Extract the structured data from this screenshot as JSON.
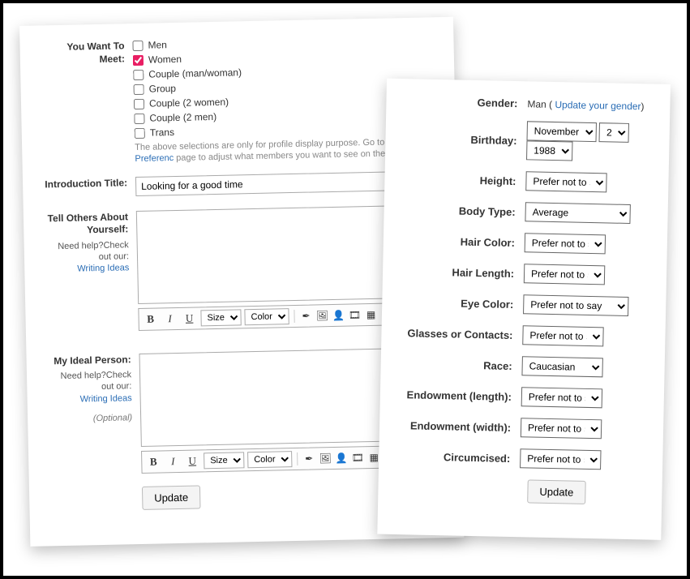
{
  "left": {
    "meet_label": "You Want To Meet:",
    "meet_options": [
      {
        "label": "Men",
        "checked": false
      },
      {
        "label": "Women",
        "checked": true
      },
      {
        "label": "Couple (man/woman)",
        "checked": false
      },
      {
        "label": "Group",
        "checked": false
      },
      {
        "label": "Couple (2 women)",
        "checked": false
      },
      {
        "label": "Couple (2 men)",
        "checked": false
      },
      {
        "label": "Trans",
        "checked": false
      }
    ],
    "meet_note_pre": "The above selections are only for profile display purpose. Go to ",
    "meet_note_link": "Cupid Preferenc",
    "meet_note_post": " page to adjust what members you want to see on the site.",
    "intro_label": "Introduction Title:",
    "intro_value": "Looking for a good time",
    "about_label": "Tell Others About Yourself:",
    "help_prefix": "Need help?Check out our:",
    "help_link": "Writing Ideas",
    "ideal_label": "My Ideal Person:",
    "optional": "(Optional)",
    "toolbar": {
      "bold": "B",
      "italic": "I",
      "underline": "U",
      "size": "Size",
      "color": "Color",
      "question": "?"
    },
    "update_btn": "Update"
  },
  "right": {
    "gender_label": "Gender:",
    "gender_value_prefix": "Man ( ",
    "gender_link": "Update your gender",
    "gender_value_suffix": ")",
    "birthday_label": "Birthday:",
    "birthday_month": "November",
    "birthday_day": "2",
    "birthday_year": "1988",
    "height_label": "Height:",
    "height_value": "Prefer not to say",
    "body_label": "Body Type:",
    "body_value": "Average",
    "hair_color_label": "Hair Color:",
    "hair_color_value": "Prefer not to say",
    "hair_length_label": "Hair Length:",
    "hair_length_value": "Prefer not to say",
    "eye_label": "Eye Color:",
    "eye_value": "Prefer not to say",
    "glasses_label": "Glasses or Contacts:",
    "glasses_value": "Prefer not to say",
    "race_label": "Race:",
    "race_value": "Caucasian",
    "endow_len_label": "Endowment (length):",
    "endow_len_value": "Prefer not to say",
    "endow_wid_label": "Endowment (width):",
    "endow_wid_value": "Prefer not to say",
    "circ_label": "Circumcised:",
    "circ_value": "Prefer not to say",
    "update_btn": "Update"
  }
}
